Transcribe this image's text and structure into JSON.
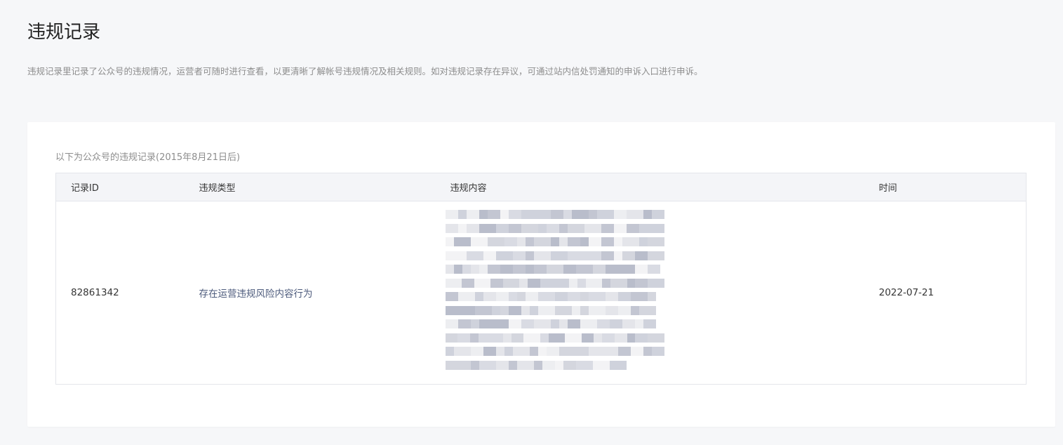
{
  "page": {
    "title": "违规记录",
    "description": "违规记录里记录了公众号的违规情况，运营者可随时进行查看，以更清晰了解帐号违规情况及相关规则。如对违规记录存在异议，可通过站内信处罚通知的申诉入口进行申诉。"
  },
  "records": {
    "caption": "以下为公众号的违规记录(2015年8月21日后)",
    "columns": [
      "记录ID",
      "违规类型",
      "违规内容",
      "时间"
    ],
    "rows": [
      {
        "id": "82861342",
        "type": "存在运营违规风险内容行为",
        "content_redacted": true,
        "time": "2022-07-21"
      }
    ]
  },
  "colors": {
    "background": "#f6f7f9",
    "card": "#ffffff",
    "table_header": "#f4f5f8",
    "border": "#e4e6eb",
    "muted_text": "#8d8d8d",
    "type_text": "#4d5b7c"
  }
}
